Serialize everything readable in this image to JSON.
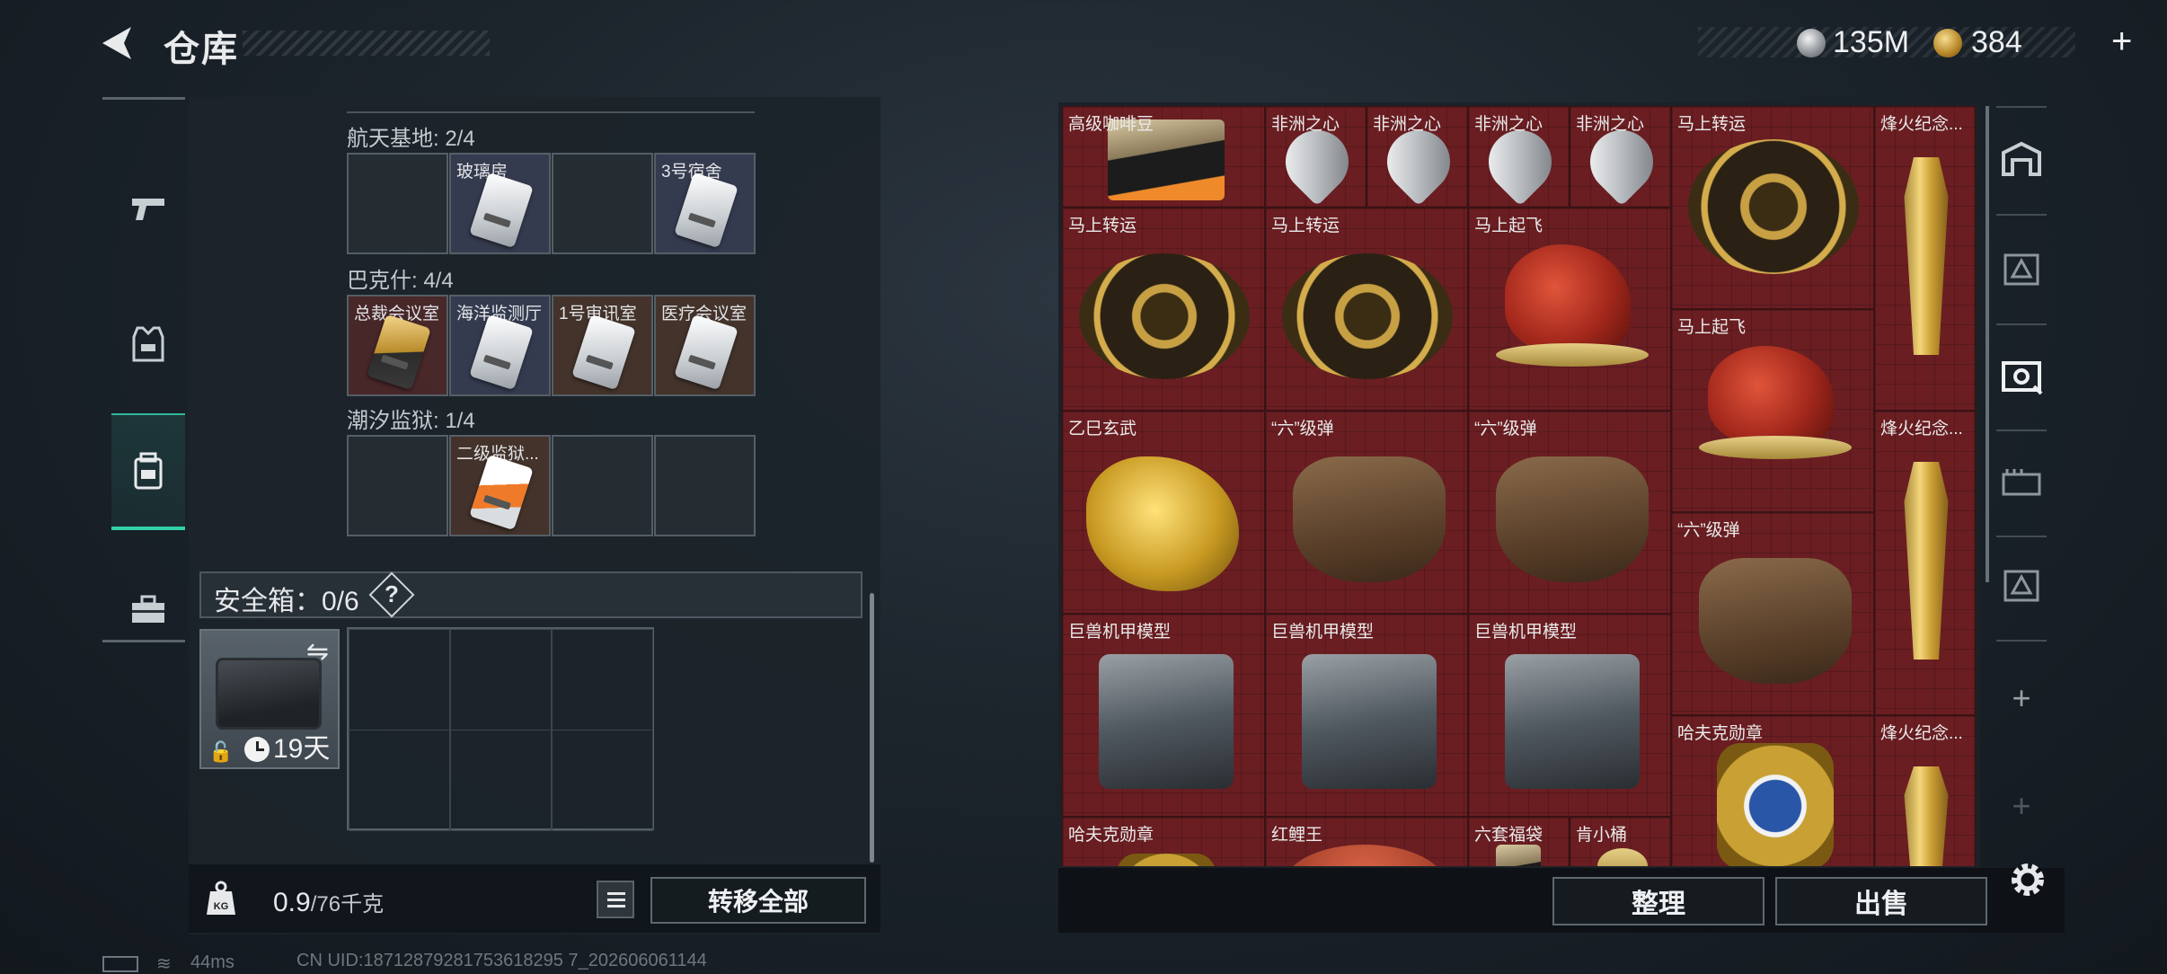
{
  "header": {
    "title": "仓库"
  },
  "currency": {
    "silver": "135M",
    "gold": "384",
    "plus": "+"
  },
  "sidebar": {
    "items": [
      {
        "icon": "pistol-icon"
      },
      {
        "icon": "armor-vest-icon"
      },
      {
        "icon": "backpack-icon",
        "active": true
      },
      {
        "icon": "toolbox-icon"
      }
    ]
  },
  "storage": {
    "sections": [
      {
        "label": "航天基地: 2/4",
        "slots": [
          "",
          "玻璃房",
          "",
          "3号宿舍"
        ]
      },
      {
        "label": "巴克什: 4/4",
        "slots": [
          "总裁会议室",
          "海洋监测厅",
          "1号审讯室",
          "医疗会议室"
        ]
      },
      {
        "label": "潮汐监狱: 1/4",
        "slots": [
          "",
          "二级监狱...",
          "",
          ""
        ]
      }
    ],
    "safe_box": {
      "label": "安全箱：0/6",
      "help": "?",
      "days": "19天"
    },
    "weight": {
      "value": "0.9",
      "unit": "/76千克"
    },
    "transfer_all": "转移全部"
  },
  "stash": {
    "items": [
      {
        "label": "高级咖啡豆"
      },
      {
        "label": "非洲之心"
      },
      {
        "label": "非洲之心"
      },
      {
        "label": "非洲之心"
      },
      {
        "label": "非洲之心"
      },
      {
        "label": "马上转运"
      },
      {
        "label": "烽火纪念..."
      },
      {
        "label": "马上转运"
      },
      {
        "label": "马上转运"
      },
      {
        "label": "马上起飞"
      },
      {
        "label": "马上起飞"
      },
      {
        "label": "乙巳玄武"
      },
      {
        "label": "“六”级弹"
      },
      {
        "label": "“六”级弹"
      },
      {
        "label": "烽火纪念..."
      },
      {
        "label": "“六”级弹"
      },
      {
        "label": "巨兽机甲模型"
      },
      {
        "label": "巨兽机甲模型"
      },
      {
        "label": "巨兽机甲模型"
      },
      {
        "label": "哈夫克勋章"
      },
      {
        "label": "烽火纪念..."
      },
      {
        "label": "哈夫克勋章"
      },
      {
        "label": "红鲤王"
      },
      {
        "label": "六套福袋"
      },
      {
        "label": "肯小桶"
      }
    ],
    "sort_button": "整理",
    "sell_button": "出售"
  },
  "status": {
    "ping": "44ms",
    "uid": "CN UID:18712879281753618295 7_202606061144"
  }
}
